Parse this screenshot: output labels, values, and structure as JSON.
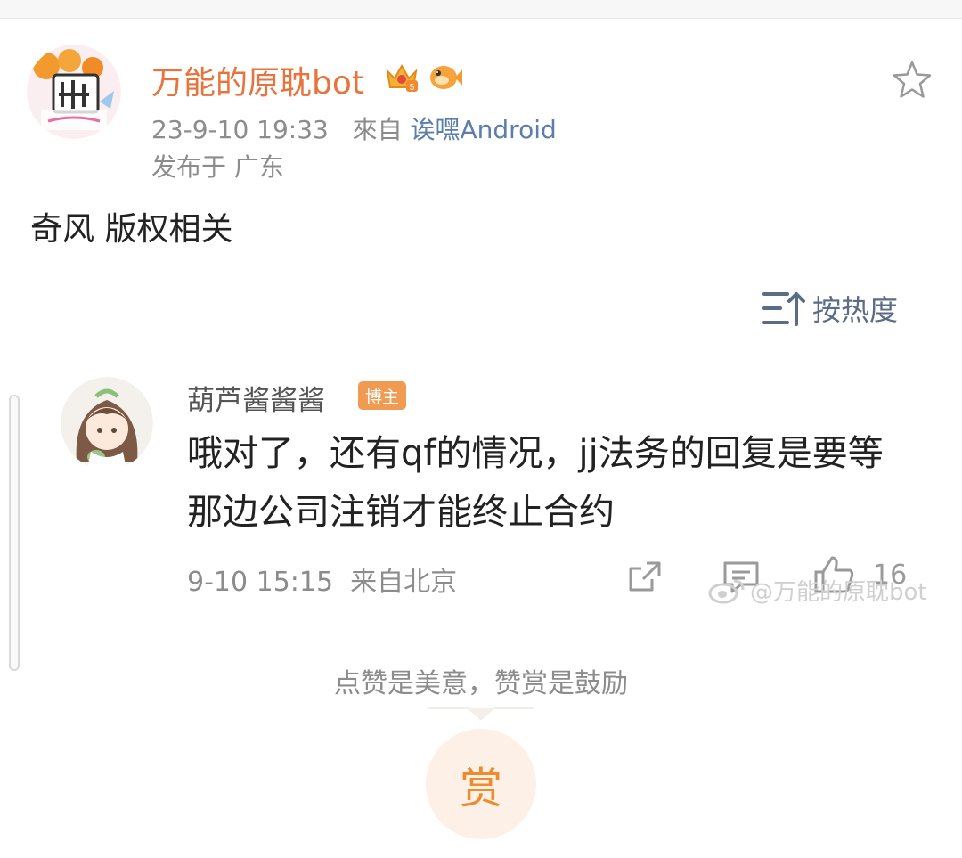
{
  "post": {
    "author_name": "万能的原耽bot",
    "time": "23-9-10 19:33",
    "source_prefix": "來自",
    "source_name": "诶嘿Android",
    "location": "发布于 广东",
    "text": "奇风 版权相关",
    "author_badges": [
      "vip-crown-badge-icon",
      "fish-badge-icon"
    ]
  },
  "sort": {
    "label": "按热度",
    "icon": "sort-icon"
  },
  "comment": {
    "name": "葫芦酱酱酱",
    "badge": "博主",
    "text": "哦对了，还有qf的情况，jj法务的回复是要等那边公司注销才能终止合约",
    "time": "9-10 15:15",
    "location": "来自北京",
    "like_count": "16"
  },
  "watermark": "@万能的原耽bot",
  "reward": {
    "tip": "点赞是美意，赞赏是鼓励",
    "button_label": "赏"
  },
  "colors": {
    "author_orange": "#e8733d",
    "link_blue": "#5b7faa",
    "badge_orange": "#f19a52",
    "reward_bg": "#fdf0e6",
    "reward_text": "#f08a2c"
  }
}
